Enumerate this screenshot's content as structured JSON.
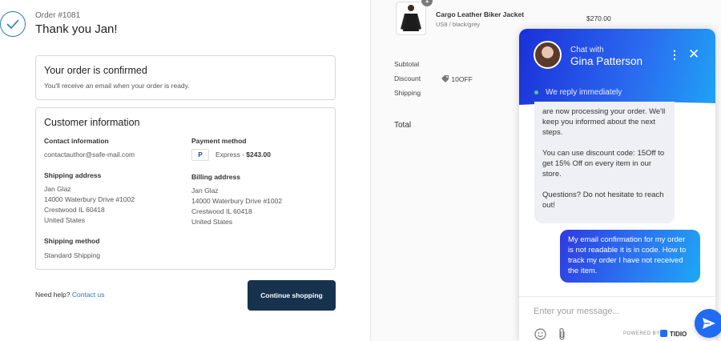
{
  "order": {
    "number": "Order #1081",
    "thanks": "Thank you Jan!",
    "confirmed_title": "Your order is confirmed",
    "confirmed_text": "You'll receive an email when your order is ready."
  },
  "customer": {
    "title": "Customer information",
    "contact_label": "Contact information",
    "contact_value": "contactauthor@safe-mail.com",
    "payment_label": "Payment method",
    "payment_icon": "P",
    "payment_prefix": "Express - ",
    "payment_amount": "$243.00",
    "shipping_label": "Shipping address",
    "shipping_lines": [
      "Jan Glaz",
      "14000 Waterbury Drive #1002",
      "Crestwood IL 60418",
      "United States"
    ],
    "billing_label": "Billing address",
    "billing_lines": [
      "Jan Glaz",
      "14000 Waterbury Drive #1002",
      "Crestwood IL 60418",
      "United States"
    ],
    "method_label": "Shipping method",
    "method_value": "Standard Shipping"
  },
  "footer": {
    "help_text": "Need help?",
    "help_link": "Contact us",
    "continue_label": "Continue shopping"
  },
  "summary": {
    "qty_badge": "1",
    "product_name": "Cargo Leather Biker Jacket",
    "product_variant": "US8 / black/grey",
    "product_price": "$270.00",
    "subtotal_label": "Subtotal",
    "discount_label": "Discount",
    "discount_code": "10OFF",
    "shipping_label": "Shipping",
    "total_label": "Total"
  },
  "chat": {
    "chat_with": "Chat with",
    "agent_name": "Gina Patterson",
    "status": "We reply immediately",
    "incoming": [
      "are now processing your order. We'll keep you informed about the next steps.",
      "You can use discount code: 15Off to get 15% Off on every item in our store.",
      "Questions? Do not hesitate to reach out!"
    ],
    "outgoing": "My email confirmation for my order is not readable it is in code. How to track my order I have not received the item.",
    "input_placeholder": "Enter your message...",
    "powered_by": "POWERED BY",
    "brand": "TIDIO"
  },
  "colors": {
    "accent": "#2a7ab8",
    "button": "#17324d",
    "chat_primary": "#1f6bf2"
  }
}
